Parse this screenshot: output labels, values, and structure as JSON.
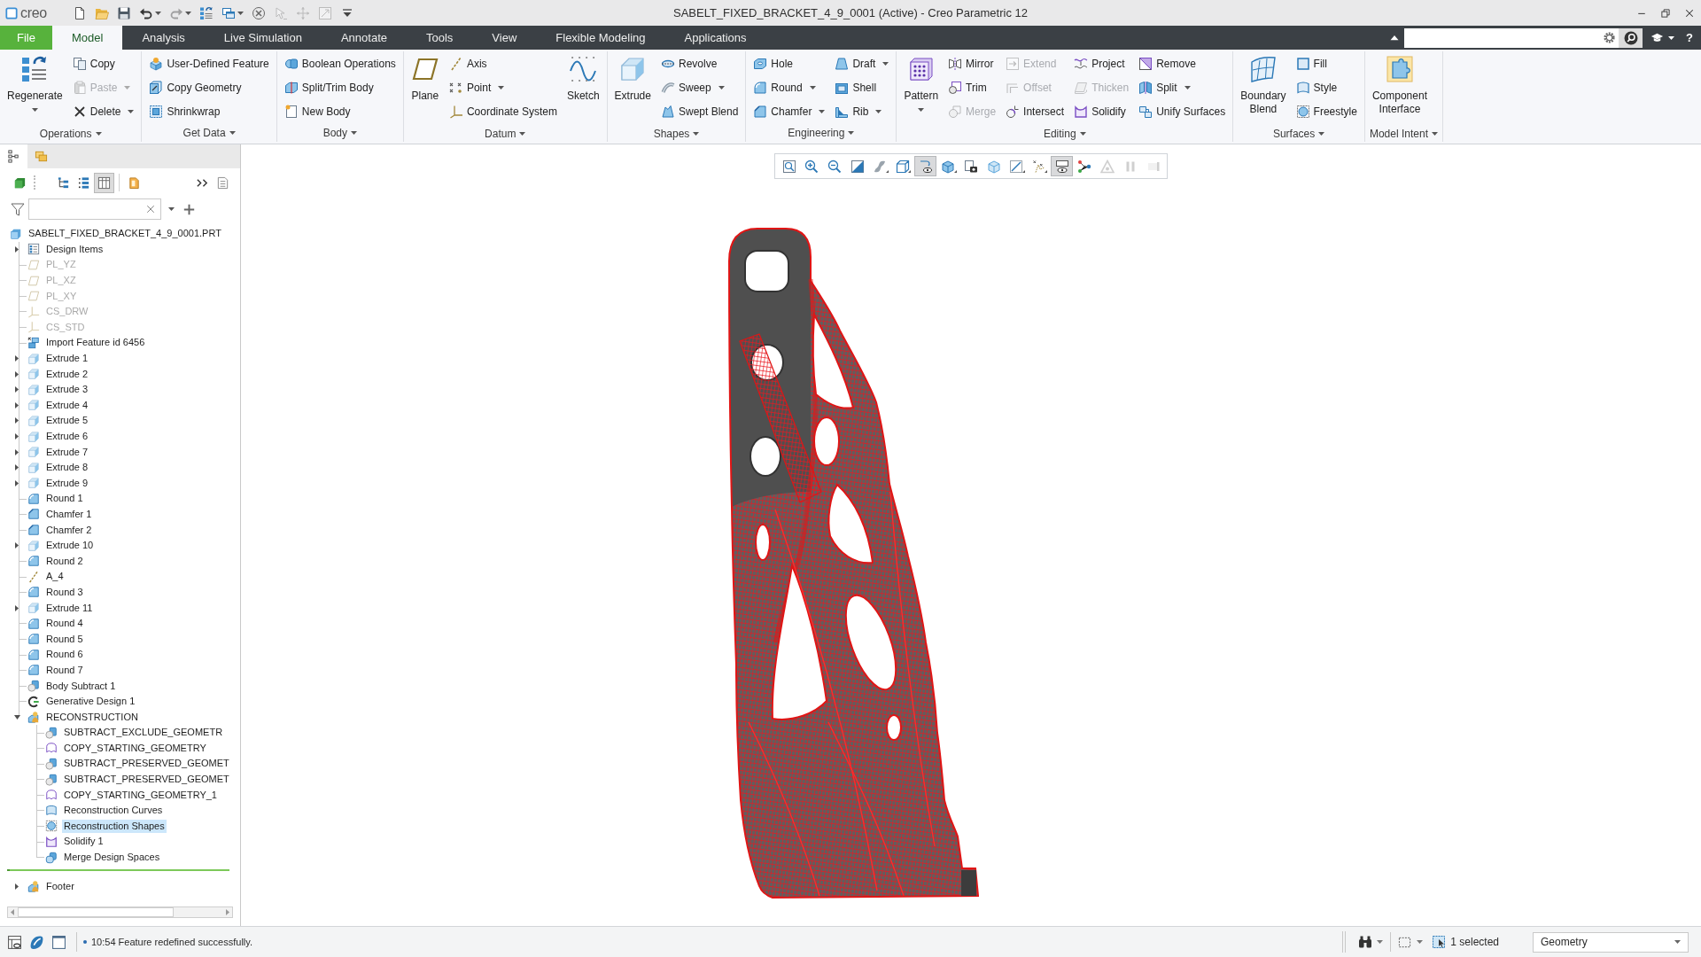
{
  "window": {
    "title": "SABELT_FIXED_BRACKET_4_9_0001 (Active) - Creo Parametric 12",
    "logo": "creo"
  },
  "quick_access": [
    {
      "kind": "new",
      "disabled": false,
      "dropdown": false
    },
    {
      "kind": "open",
      "disabled": false,
      "dropdown": false
    },
    {
      "kind": "save",
      "disabled": false,
      "dropdown": false
    },
    {
      "kind": "undo",
      "disabled": false,
      "dropdown": true
    },
    {
      "kind": "redo",
      "disabled": true,
      "dropdown": true
    },
    {
      "kind": "regenerate",
      "disabled": false,
      "dropdown": false
    },
    {
      "kind": "windows",
      "disabled": false,
      "dropdown": true
    },
    {
      "kind": "close",
      "disabled": false,
      "dropdown": false
    },
    {
      "kind": "edit",
      "disabled": true,
      "dropdown": false
    },
    {
      "kind": "move",
      "disabled": true,
      "dropdown": false
    },
    {
      "kind": "resize",
      "disabled": true,
      "dropdown": false
    },
    {
      "kind": "customize",
      "disabled": false,
      "dropdown": false
    }
  ],
  "menu_bar": {
    "tabs": [
      {
        "label": "File",
        "kind": "application",
        "selected": false
      },
      {
        "label": "Model",
        "kind": "tab",
        "selected": true
      },
      {
        "label": "Analysis",
        "kind": "tab",
        "selected": false
      },
      {
        "label": "Live Simulation",
        "kind": "tab",
        "selected": false
      },
      {
        "label": "Annotate",
        "kind": "tab",
        "selected": false
      },
      {
        "label": "Tools",
        "kind": "tab",
        "selected": false
      },
      {
        "label": "View",
        "kind": "tab",
        "selected": false
      },
      {
        "label": "Flexible Modeling",
        "kind": "tab",
        "selected": false
      },
      {
        "label": "Applications",
        "kind": "tab",
        "selected": false
      }
    ],
    "help": "?"
  },
  "ribbon": {
    "groups": [
      {
        "label": "Operations",
        "columns": [
          {
            "kind": "large",
            "items": [
              {
                "label": "Regenerate",
                "kind": "regenerate",
                "disabled": false,
                "dropdown": true
              }
            ]
          },
          {
            "kind": "small",
            "items": [
              {
                "label": "Copy",
                "kind": "copy",
                "disabled": false,
                "dropdown": false
              },
              {
                "label": "Paste",
                "kind": "paste",
                "disabled": true,
                "dropdown": true
              },
              {
                "label": "Delete",
                "kind": "delete",
                "disabled": false,
                "dropdown": true
              }
            ]
          }
        ]
      },
      {
        "label": "Get Data",
        "columns": [
          {
            "kind": "small",
            "items": [
              {
                "label": "User-Defined Feature",
                "kind": "udf",
                "disabled": false,
                "dropdown": false
              },
              {
                "label": "Copy Geometry",
                "kind": "copy_geometry",
                "disabled": false,
                "dropdown": false
              },
              {
                "label": "Shrinkwrap",
                "kind": "shrinkwrap",
                "disabled": false,
                "dropdown": false
              }
            ]
          }
        ]
      },
      {
        "label": "Body",
        "columns": [
          {
            "kind": "small",
            "items": [
              {
                "label": "Boolean Operations",
                "kind": "boolean",
                "disabled": false,
                "dropdown": false
              },
              {
                "label": "Split/Trim Body",
                "kind": "split_body",
                "disabled": false,
                "dropdown": false
              },
              {
                "label": "New Body",
                "kind": "new_body",
                "disabled": false,
                "dropdown": false
              }
            ]
          }
        ]
      },
      {
        "label": "Datum",
        "columns": [
          {
            "kind": "large",
            "items": [
              {
                "label": "Plane",
                "kind": "plane",
                "disabled": false,
                "dropdown": false
              }
            ]
          },
          {
            "kind": "small",
            "items": [
              {
                "label": "Axis",
                "kind": "axis",
                "disabled": false,
                "dropdown": false
              },
              {
                "label": "Point",
                "kind": "point",
                "disabled": false,
                "dropdown": true
              },
              {
                "label": "Coordinate System",
                "kind": "csys",
                "disabled": false,
                "dropdown": false
              }
            ]
          },
          {
            "kind": "large",
            "items": [
              {
                "label": "Sketch",
                "kind": "sketch",
                "disabled": false,
                "dropdown": false
              }
            ]
          }
        ]
      },
      {
        "label": "Shapes",
        "columns": [
          {
            "kind": "large",
            "items": [
              {
                "label": "Extrude",
                "kind": "extrude",
                "disabled": false,
                "dropdown": false
              }
            ]
          },
          {
            "kind": "small",
            "items": [
              {
                "label": "Revolve",
                "kind": "revolve",
                "disabled": false,
                "dropdown": false
              },
              {
                "label": "Sweep",
                "kind": "sweep",
                "disabled": false,
                "dropdown": true
              },
              {
                "label": "Swept Blend",
                "kind": "swept_blend",
                "disabled": false,
                "dropdown": false
              }
            ]
          }
        ]
      },
      {
        "label": "Engineering",
        "columns": [
          {
            "kind": "small",
            "items": [
              {
                "label": "Hole",
                "kind": "hole",
                "disabled": false,
                "dropdown": false
              },
              {
                "label": "Round",
                "kind": "round",
                "disabled": false,
                "dropdown": true
              },
              {
                "label": "Chamfer",
                "kind": "chamfer",
                "disabled": false,
                "dropdown": true
              }
            ]
          },
          {
            "kind": "small",
            "items": [
              {
                "label": "Draft",
                "kind": "draft",
                "disabled": false,
                "dropdown": true
              },
              {
                "label": "Shell",
                "kind": "shell",
                "disabled": false,
                "dropdown": false
              },
              {
                "label": "Rib",
                "kind": "rib",
                "disabled": false,
                "dropdown": true
              }
            ]
          }
        ]
      },
      {
        "label": "Editing",
        "columns": [
          {
            "kind": "large",
            "items": [
              {
                "label": "Pattern",
                "kind": "pattern",
                "disabled": false,
                "dropdown": true
              }
            ]
          },
          {
            "kind": "small",
            "items": [
              {
                "label": "Mirror",
                "kind": "mirror",
                "disabled": false,
                "dropdown": false
              },
              {
                "label": "Trim",
                "kind": "trim",
                "disabled": false,
                "dropdown": false
              },
              {
                "label": "Merge",
                "kind": "merge",
                "disabled": true,
                "dropdown": false
              }
            ]
          },
          {
            "kind": "small",
            "items": [
              {
                "label": "Extend",
                "kind": "extend",
                "disabled": true,
                "dropdown": false
              },
              {
                "label": "Offset",
                "kind": "offset",
                "disabled": true,
                "dropdown": false
              },
              {
                "label": "Intersect",
                "kind": "intersect",
                "disabled": false,
                "dropdown": false
              }
            ]
          },
          {
            "kind": "small",
            "items": [
              {
                "label": "Project",
                "kind": "project",
                "disabled": false,
                "dropdown": false
              },
              {
                "label": "Thicken",
                "kind": "thicken",
                "disabled": true,
                "dropdown": false
              },
              {
                "label": "Solidify",
                "kind": "solidify",
                "disabled": false,
                "dropdown": false
              }
            ]
          },
          {
            "kind": "small",
            "items": [
              {
                "label": "Remove",
                "kind": "remove",
                "disabled": false,
                "dropdown": false
              },
              {
                "label": "Split",
                "kind": "split",
                "disabled": false,
                "dropdown": true
              },
              {
                "label": "Unify Surfaces",
                "kind": "unify",
                "disabled": false,
                "dropdown": false
              }
            ]
          }
        ]
      },
      {
        "label": "Surfaces",
        "columns": [
          {
            "kind": "large",
            "items": [
              {
                "label": "Boundary Blend",
                "kind": "boundary_blend",
                "disabled": false,
                "dropdown": false
              }
            ]
          },
          {
            "kind": "small",
            "items": [
              {
                "label": "Fill",
                "kind": "fill",
                "disabled": false,
                "dropdown": false
              },
              {
                "label": "Style",
                "kind": "style",
                "disabled": false,
                "dropdown": false
              },
              {
                "label": "Freestyle",
                "kind": "freestyle",
                "disabled": false,
                "dropdown": false
              }
            ]
          }
        ]
      },
      {
        "label": "Model Intent",
        "columns": [
          {
            "kind": "large",
            "items": [
              {
                "label": "Component Interface",
                "kind": "component_interface",
                "disabled": false,
                "dropdown": false
              }
            ]
          }
        ]
      }
    ]
  },
  "model_tree": {
    "tabs": [
      {
        "kind": "tab_tree",
        "selected": true
      },
      {
        "kind": "tab_layers",
        "selected": false
      }
    ],
    "tools": [
      {
        "kind": "display",
        "on": false
      },
      {
        "kind": "tree_columns",
        "on": false
      },
      {
        "kind": "tree_filters",
        "on": false
      },
      {
        "kind": "columns",
        "on": true
      },
      {
        "kind": "highlight",
        "on": false
      },
      {
        "kind": "more",
        "on": false
      },
      {
        "kind": "notes",
        "on": false
      }
    ],
    "root": {
      "label": "SABELT_FIXED_BRACKET_4_9_0001.PRT",
      "kind": "part",
      "selected": false,
      "dimmed": false,
      "children": [
        {
          "label": "Design Items",
          "kind": "design_items",
          "selected": false,
          "dimmed": false,
          "expanded": false
        },
        {
          "label": "PL_YZ",
          "kind": "plane",
          "selected": false,
          "dimmed": true
        },
        {
          "label": "PL_XZ",
          "kind": "plane",
          "selected": false,
          "dimmed": true
        },
        {
          "label": "PL_XY",
          "kind": "plane",
          "selected": false,
          "dimmed": true
        },
        {
          "label": "CS_DRW",
          "kind": "csys",
          "selected": false,
          "dimmed": true
        },
        {
          "label": "CS_STD",
          "kind": "csys",
          "selected": false,
          "dimmed": true
        },
        {
          "label": "Import Feature id 6456",
          "kind": "import",
          "selected": false,
          "dimmed": false
        },
        {
          "label": "Extrude 1",
          "kind": "extrude",
          "selected": false,
          "dimmed": false,
          "expanded": false
        },
        {
          "label": "Extrude 2",
          "kind": "extrude",
          "selected": false,
          "dimmed": false,
          "expanded": false
        },
        {
          "label": "Extrude 3",
          "kind": "extrude",
          "selected": false,
          "dimmed": false,
          "expanded": false
        },
        {
          "label": "Extrude 4",
          "kind": "extrude",
          "selected": false,
          "dimmed": false,
          "expanded": false
        },
        {
          "label": "Extrude 5",
          "kind": "extrude",
          "selected": false,
          "dimmed": false,
          "expanded": false
        },
        {
          "label": "Extrude 6",
          "kind": "extrude",
          "selected": false,
          "dimmed": false,
          "expanded": false
        },
        {
          "label": "Extrude 7",
          "kind": "extrude",
          "selected": false,
          "dimmed": false,
          "expanded": false
        },
        {
          "label": "Extrude 8",
          "kind": "extrude",
          "selected": false,
          "dimmed": false,
          "expanded": false
        },
        {
          "label": "Extrude 9",
          "kind": "extrude",
          "selected": false,
          "dimmed": false,
          "expanded": false
        },
        {
          "label": "Round 1",
          "kind": "round",
          "selected": false,
          "dimmed": false
        },
        {
          "label": "Chamfer 1",
          "kind": "chamfer",
          "selected": false,
          "dimmed": false
        },
        {
          "label": "Chamfer 2",
          "kind": "chamfer",
          "selected": false,
          "dimmed": false
        },
        {
          "label": "Extrude 10",
          "kind": "extrude",
          "selected": false,
          "dimmed": false,
          "expanded": false
        },
        {
          "label": "Round 2",
          "kind": "round",
          "selected": false,
          "dimmed": false
        },
        {
          "label": "A_4",
          "kind": "axis",
          "selected": false,
          "dimmed": false
        },
        {
          "label": "Round 3",
          "kind": "round",
          "selected": false,
          "dimmed": false
        },
        {
          "label": "Extrude 11",
          "kind": "extrude",
          "selected": false,
          "dimmed": false,
          "expanded": false
        },
        {
          "label": "Round 4",
          "kind": "round",
          "selected": false,
          "dimmed": false
        },
        {
          "label": "Round 5",
          "kind": "round",
          "selected": false,
          "dimmed": false
        },
        {
          "label": "Round 6",
          "kind": "round",
          "selected": false,
          "dimmed": false
        },
        {
          "label": "Round 7",
          "kind": "round",
          "selected": false,
          "dimmed": false
        },
        {
          "label": "Body Subtract 1",
          "kind": "subtract",
          "selected": false,
          "dimmed": false
        },
        {
          "label": "Generative Design 1",
          "kind": "generative",
          "selected": false,
          "dimmed": false
        },
        {
          "label": "RECONSTRUCTION",
          "kind": "group",
          "selected": false,
          "dimmed": false,
          "expanded": true,
          "children": [
            {
              "label": "SUBTRACT_EXCLUDE_GEOMETR",
              "kind": "subtract",
              "selected": false,
              "dimmed": false
            },
            {
              "label": "COPY_STARTING_GEOMETRY",
              "kind": "copy_geom",
              "selected": false,
              "dimmed": false
            },
            {
              "label": "SUBTRACT_PRESERVED_GEOMET",
              "kind": "subtract",
              "selected": false,
              "dimmed": false
            },
            {
              "label": "SUBTRACT_PRESERVED_GEOMET",
              "kind": "subtract",
              "selected": false,
              "dimmed": false
            },
            {
              "label": "COPY_STARTING_GEOMETRY_1",
              "kind": "copy_geom",
              "selected": false,
              "dimmed": false
            },
            {
              "label": "Reconstruction Curves",
              "kind": "curves",
              "selected": false,
              "dimmed": false
            },
            {
              "label": "Reconstruction Shapes",
              "kind": "shapes",
              "selected": true,
              "dimmed": false
            },
            {
              "label": "Solidify 1",
              "kind": "solidify",
              "selected": false,
              "dimmed": false
            },
            {
              "label": "Merge Design Spaces",
              "kind": "merge_spaces",
              "selected": false,
              "dimmed": false
            }
          ]
        }
      ]
    },
    "footer": {
      "label": "Footer",
      "kind": "group",
      "selected": false,
      "dimmed": false,
      "expanded": false
    }
  },
  "view_toolbar": [
    {
      "kind": "refit",
      "on": false,
      "disabled": false,
      "dropdown": false
    },
    {
      "kind": "zoom_in",
      "on": false,
      "disabled": false,
      "dropdown": false
    },
    {
      "kind": "zoom_out",
      "on": false,
      "disabled": false,
      "dropdown": false
    },
    {
      "kind": "repaint",
      "on": false,
      "disabled": false,
      "dropdown": false
    },
    {
      "kind": "spin",
      "on": false,
      "disabled": false,
      "dropdown": true
    },
    {
      "kind": "saved_views",
      "on": false,
      "disabled": false,
      "dropdown": true
    },
    {
      "kind": "curve_eye",
      "on": true,
      "disabled": false,
      "dropdown": false
    },
    {
      "kind": "display_style",
      "on": false,
      "disabled": false,
      "dropdown": true
    },
    {
      "kind": "photo",
      "on": false,
      "disabled": false,
      "dropdown": false
    },
    {
      "kind": "glass_cube",
      "on": false,
      "disabled": false,
      "dropdown": false
    },
    {
      "kind": "datum_display",
      "on": false,
      "disabled": false,
      "dropdown": true
    },
    {
      "kind": "points",
      "on": false,
      "disabled": false,
      "dropdown": true
    },
    {
      "kind": "eye_filter",
      "on": true,
      "disabled": false,
      "dropdown": false
    },
    {
      "kind": "nodes",
      "on": false,
      "disabled": false,
      "dropdown": false
    },
    {
      "kind": "triangle",
      "on": false,
      "disabled": true,
      "dropdown": false
    },
    {
      "kind": "pause",
      "on": false,
      "disabled": true,
      "dropdown": false
    },
    {
      "kind": "annotation",
      "on": false,
      "disabled": true,
      "dropdown": false
    }
  ],
  "status_bar": {
    "message": "10:54 Feature redefined successfully.",
    "selection": "1 selected",
    "filter": "Geometry"
  }
}
